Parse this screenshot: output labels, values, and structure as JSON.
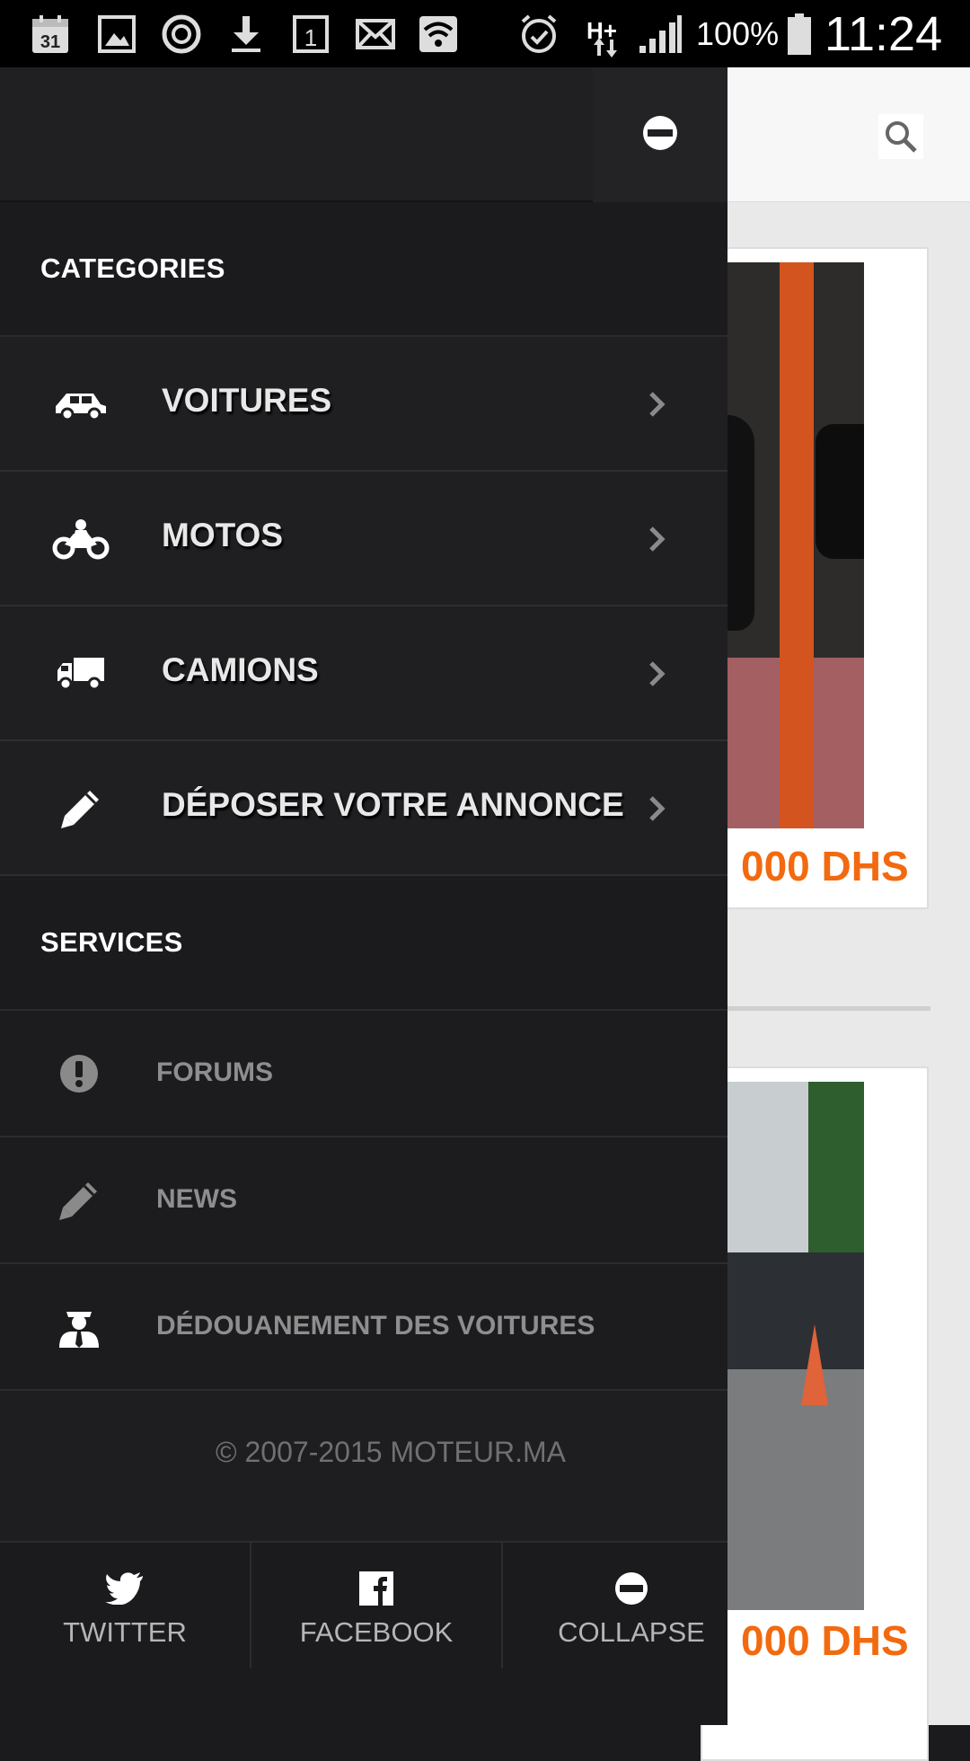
{
  "status_bar": {
    "battery": "100%",
    "time": "11:24",
    "calendar_day": "31",
    "network": "H+",
    "sim_slot": "1",
    "icons": [
      "calendar-icon",
      "gallery-icon",
      "sync-icon",
      "download-icon",
      "sim-icon",
      "mail-icon",
      "wifi-icon",
      "alarm-icon",
      "data-arrows-icon",
      "signal-icon",
      "battery-icon"
    ]
  },
  "background_page": {
    "listings": [
      {
        "price": "000 DHS"
      },
      {
        "price": "000 DHS"
      }
    ]
  },
  "drawer": {
    "sections": {
      "categories": "CATEGORIES",
      "services": "SERVICES"
    },
    "categories": [
      {
        "label": "VOITURES",
        "icon": "car-icon"
      },
      {
        "label": "MOTOS",
        "icon": "motorcycle-icon"
      },
      {
        "label": "CAMIONS",
        "icon": "truck-icon"
      },
      {
        "label": "DÉPOSER VOTRE ANNONCE",
        "icon": "pencil-icon"
      }
    ],
    "services": [
      {
        "label": "FORUMS",
        "icon": "exclamation-icon"
      },
      {
        "label": "NEWS",
        "icon": "pencil-icon"
      },
      {
        "label": "DÉDOUANEMENT DES VOITURES",
        "icon": "customs-officer-icon"
      }
    ],
    "copyright": "© 2007-2015 MOTEUR.MA",
    "bottom_buttons": [
      {
        "label": "TWITTER",
        "icon": "twitter-icon"
      },
      {
        "label": "FACEBOOK",
        "icon": "facebook-icon"
      },
      {
        "label": "COLLAPSE",
        "icon": "collapse-icon"
      }
    ]
  },
  "colors": {
    "accent_price": "#f26a10",
    "drawer_bg": "#1e1e20",
    "status_bar": "#000000"
  }
}
